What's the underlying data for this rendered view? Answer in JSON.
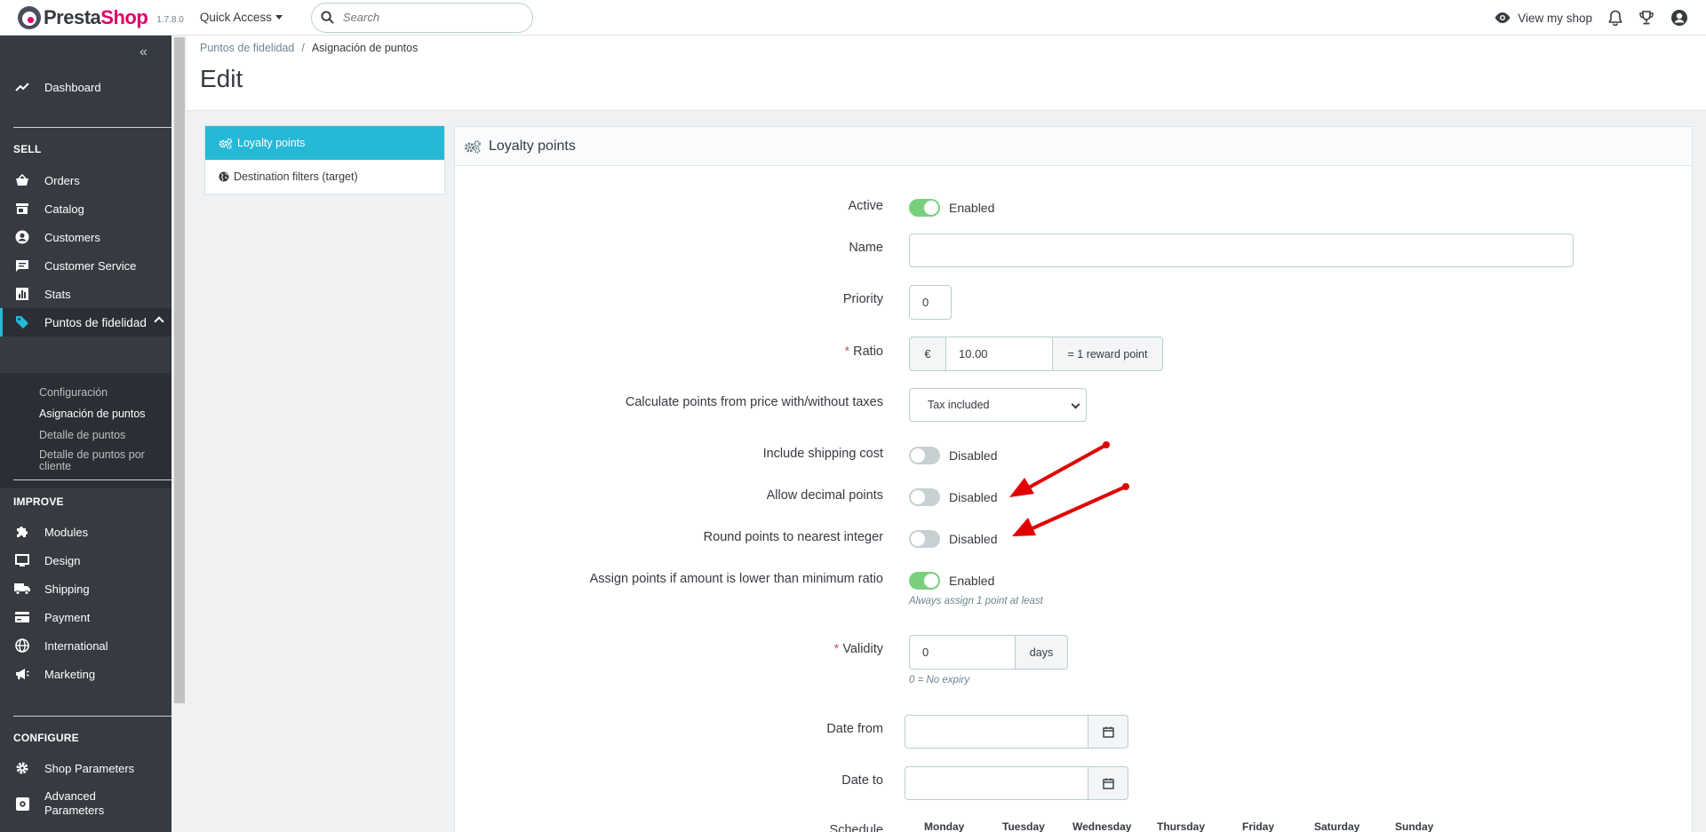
{
  "header": {
    "logo_presta": "Presta",
    "logo_shop": "Shop",
    "version": "1.7.8.0",
    "quick_access": "Quick Access",
    "search_placeholder": "Search",
    "view_shop": "View my shop"
  },
  "sidebar": {
    "dashboard": "Dashboard",
    "sell_title": "SELL",
    "sell_items": [
      "Orders",
      "Catalog",
      "Customers",
      "Customer Service",
      "Stats",
      "Puntos de fidelidad"
    ],
    "sub_items": [
      "Configuración",
      "Asignación de puntos",
      "Detalle de puntos",
      "Detalle de puntos por cliente"
    ],
    "improve_title": "IMPROVE",
    "improve_items": [
      "Modules",
      "Design",
      "Shipping",
      "Payment",
      "International",
      "Marketing"
    ],
    "configure_title": "CONFIGURE",
    "configure_items": [
      "Shop Parameters",
      "Advanced Parameters"
    ]
  },
  "page": {
    "breadcrumb_parent": "Puntos de fidelidad",
    "breadcrumb_separator": "/",
    "breadcrumb_current": "Asignación de puntos",
    "title": "Edit"
  },
  "tabs": [
    "Loyalty points",
    "Destination filters (target)"
  ],
  "panel": {
    "title": "Loyalty points"
  },
  "form": {
    "active_label": "Active",
    "active_state": "Enabled",
    "name_label": "Name",
    "name_value": "",
    "priority_label": "Priority",
    "priority_value": "0",
    "ratio_label": "Ratio",
    "ratio_required": "*",
    "ratio_currency": "€",
    "ratio_value": "10.00",
    "ratio_suffix": "= 1 reward point",
    "tax_label": "Calculate points from price with/without taxes",
    "tax_value": "Tax included",
    "shipping_label": "Include shipping cost",
    "shipping_state": "Disabled",
    "decimal_label": "Allow decimal points",
    "decimal_state": "Disabled",
    "round_label": "Round points to nearest integer",
    "round_state": "Disabled",
    "assign_label": "Assign points if amount is lower than minimum ratio",
    "assign_state": "Enabled",
    "assign_help": "Always assign 1 point at least",
    "validity_label": "Validity",
    "validity_required": "*",
    "validity_value": "0",
    "validity_suffix": "days",
    "validity_help": "0 = No expiry",
    "date_from_label": "Date from",
    "date_from_value": "",
    "date_to_label": "Date to",
    "date_to_value": "",
    "schedule_label": "Schedule",
    "days": [
      "Monday",
      "Tuesday",
      "Wednesday",
      "Thursday",
      "Friday",
      "Saturday",
      "Sunday"
    ]
  },
  "colors": {
    "accent": "#25b9d7",
    "brand": "#df0067",
    "sidebar_bg": "#363a41",
    "switch_on": "#78d07d",
    "switch_off": "#c7d0d3",
    "annotation_arrow": "#e00000"
  }
}
